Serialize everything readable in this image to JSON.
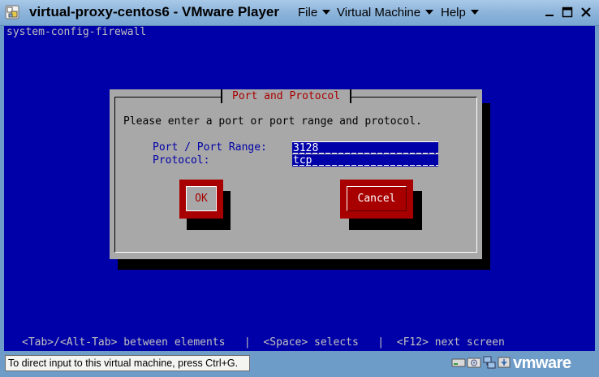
{
  "window": {
    "title": "virtual-proxy-centos6 - VMware Player",
    "menus": [
      {
        "label": "File"
      },
      {
        "label": "Virtual Machine"
      },
      {
        "label": "Help"
      }
    ]
  },
  "console": {
    "header": "system-config-firewall",
    "footer": "<Tab>/<Alt-Tab> between elements   |  <Space> selects   |  <F12> next screen",
    "background": "#0000a8"
  },
  "dialog": {
    "title": "Port and Protocol",
    "prompt": "Please enter a port or port range and protocol.",
    "fields": [
      {
        "label": "Port / Port Range:",
        "value": "3128"
      },
      {
        "label": "Protocol:",
        "value": "tcp"
      }
    ],
    "buttons": {
      "ok": "OK",
      "cancel": "Cancel"
    }
  },
  "statusbar": {
    "message": "To direct input to this virtual machine, press Ctrl+G.",
    "brand": "vmware",
    "devices": [
      "hard-disk-icon",
      "cd-drive-icon",
      "network-adapter-icon",
      "usb-icon"
    ]
  },
  "colors": {
    "title_gradient_top": "#a9c9e8",
    "chrome": "#6e9cc8",
    "dialog_bg": "#a8a8a8",
    "title_red": "#a80000",
    "button_red": "#a80000"
  }
}
